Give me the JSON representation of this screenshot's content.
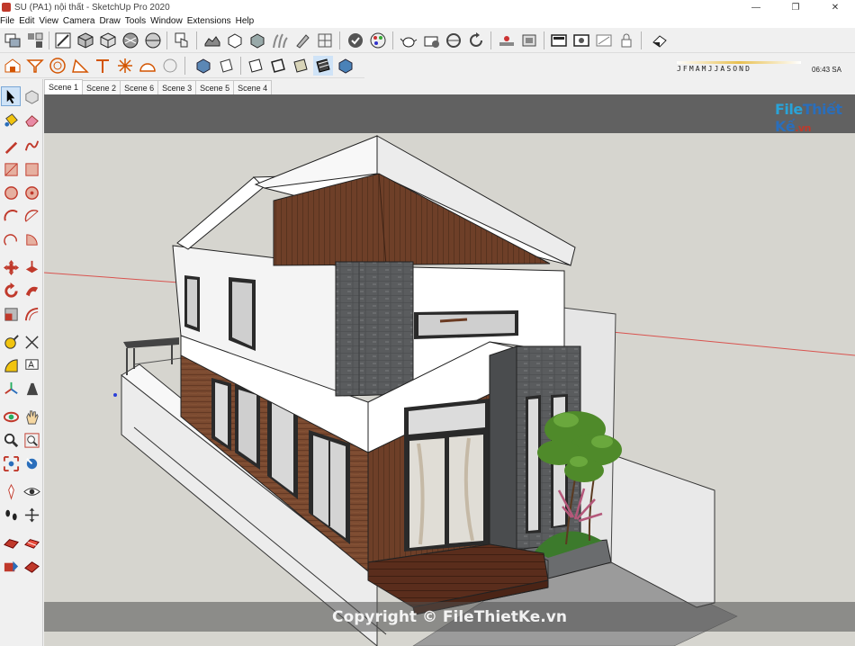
{
  "window": {
    "title": "SU (PA1) nội thất - SketchUp Pro 2020",
    "minimize": "—",
    "restore": "❐",
    "close": "✕"
  },
  "menu": [
    "File",
    "Edit",
    "View",
    "Camera",
    "Draw",
    "Tools",
    "Window",
    "Extensions",
    "Help"
  ],
  "brand": {
    "text_a": "File",
    "text_b": "Thiết Kế",
    "text_c": ".vn"
  },
  "shadow": {
    "months": "JFMAMJJASOND",
    "time": "06:43 SA"
  },
  "scenes": {
    "active_index": 0,
    "tabs": [
      "Scene 1",
      "Scene 2",
      "Scene 6",
      "Scene 3",
      "Scene 5",
      "Scene 4"
    ]
  },
  "watermark": "Copyright © FileThietKe.vn",
  "colors": {
    "accent": "#2a6ebb",
    "selection": "#cfe3f7",
    "wood": "#7b4a30",
    "stone": "#5e6062",
    "wall": "#ffffff",
    "axis_red": "#d9534f"
  }
}
